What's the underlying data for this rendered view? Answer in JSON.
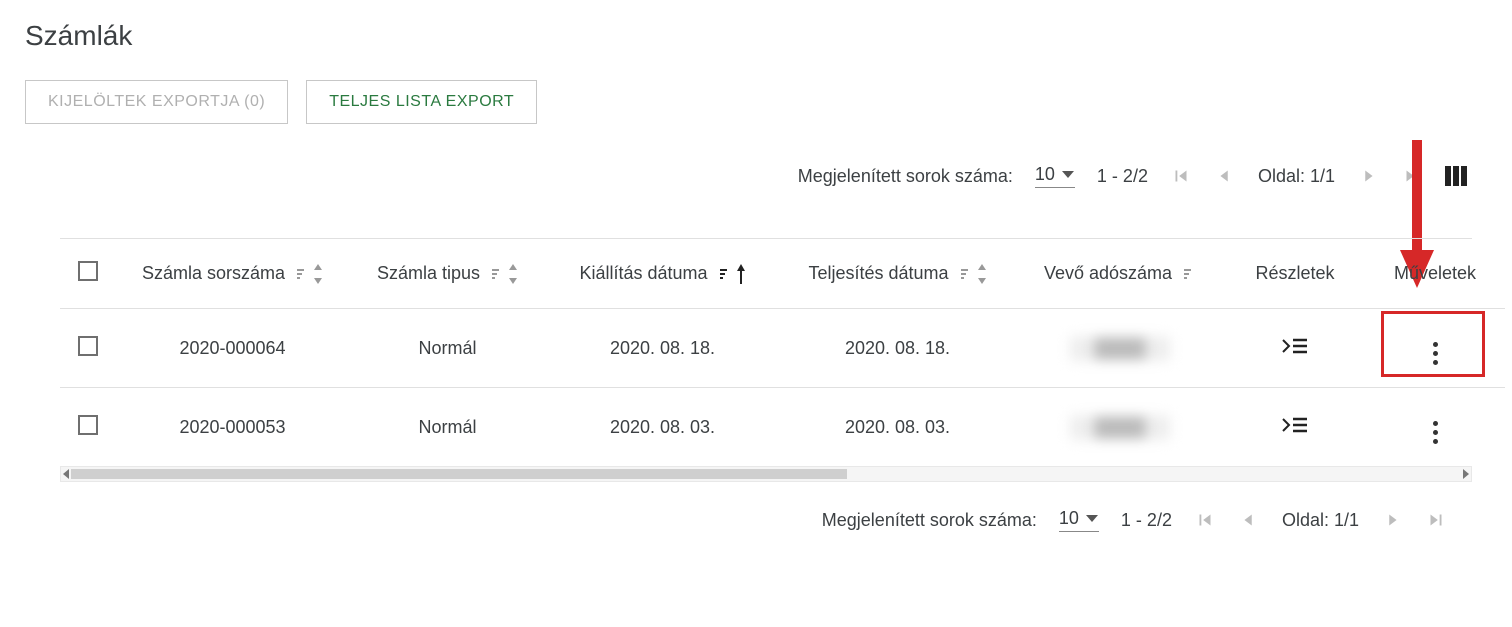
{
  "page": {
    "title": "Számlák"
  },
  "toolbar": {
    "export_selected": "KIJELÖLTEK EXPORTJA (0)",
    "export_all": "TELJES LISTA EXPORT"
  },
  "pager": {
    "rows_label": "Megjelenített sorok száma:",
    "page_size": "10",
    "range": "1 - 2/2",
    "page_label": "Oldal: 1/1"
  },
  "columns": {
    "number": "Számla sorszáma",
    "type": "Számla tipus",
    "issue_date": "Kiállítás dátuma",
    "fulfil_date": "Teljesítés dátuma",
    "buyer_tax": "Vevő adószáma",
    "details": "Részletek",
    "actions": "Műveletek"
  },
  "rows": [
    {
      "number": "2020-000064",
      "type": "Normál",
      "issue_date": "2020. 08. 18.",
      "fulfil_date": "2020. 08. 18.",
      "buyer_tax": "████"
    },
    {
      "number": "2020-000053",
      "type": "Normál",
      "issue_date": "2020. 08. 03.",
      "fulfil_date": "2020. 08. 03.",
      "buyer_tax": "████"
    }
  ]
}
